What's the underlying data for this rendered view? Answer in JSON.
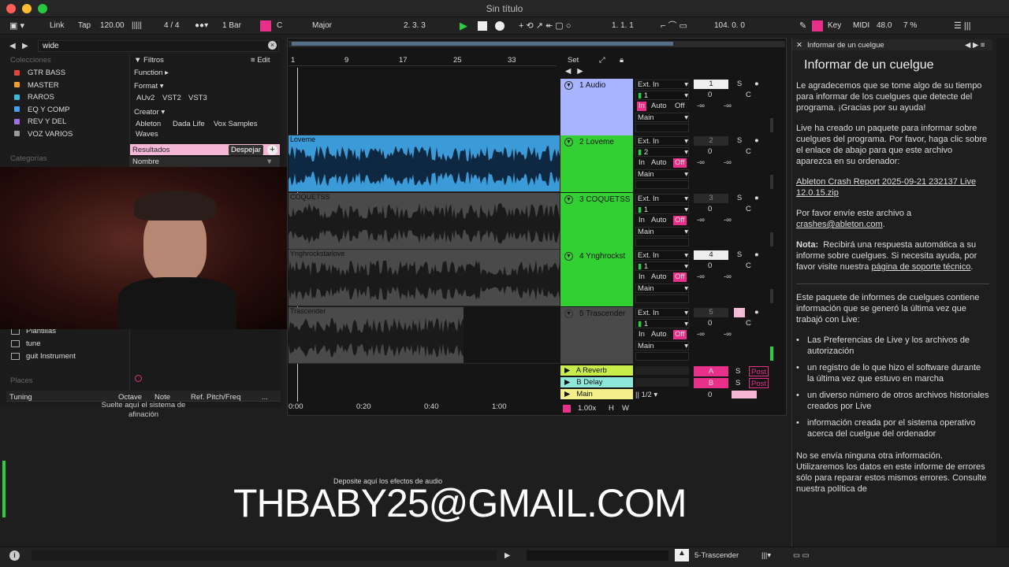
{
  "window": {
    "title": "Sin título"
  },
  "control": {
    "link": "Link",
    "tap": "Tap",
    "tempo": "120.00",
    "signature": "4 / 4",
    "quantize": "1 Bar",
    "key_root": "C",
    "scale": "Major",
    "position": "2.   3.   3",
    "loop_start": "1.   1.   1",
    "loop_length": "104.   0.   0",
    "key_label": "Key",
    "midi_label": "MIDI",
    "cpu_value": "48.0",
    "cpu_percent": "7 %"
  },
  "browser": {
    "search_value": "wide",
    "collections_label": "Colecciones",
    "collections": [
      {
        "label": "GTR BASS",
        "color": "#e0443b"
      },
      {
        "label": "MASTER",
        "color": "#f0a030"
      },
      {
        "label": "RAROS",
        "color": "#3fb8d8"
      },
      {
        "label": "EQ Y COMP",
        "color": "#4aa0f0"
      },
      {
        "label": "REV Y DEL",
        "color": "#a070e0"
      },
      {
        "label": "VOZ VARIOS",
        "color": "#999999"
      }
    ],
    "categories_label": "Categorías",
    "filters_label": "Filtros",
    "edit_label": "Edit",
    "function_label": "Function ▸",
    "format_label": "Format ▾",
    "formats": [
      "AUv2",
      "VST2",
      "VST3"
    ],
    "creator_label": "Creator ▾",
    "creators": [
      "Ableton",
      "Dada Life",
      "Vox Samples",
      "Waves"
    ],
    "results_label": "Resultados",
    "clear_label": "Despejar",
    "name_column": "Nombre",
    "places": [
      "Plantillas",
      "tune",
      "guit Instrument"
    ],
    "places_label": "Places"
  },
  "tuning": {
    "title": "Tuning",
    "col_octave": "Octave",
    "col_note": "Note",
    "col_ref": "Ref. Pitch/Freq",
    "more": "...",
    "drop_hint": "Suelte aquí el sistema de afinación"
  },
  "arrangement": {
    "bar_markers": [
      "1",
      "9",
      "17",
      "25",
      "33"
    ],
    "set_label": "Set",
    "time_markers": [
      "0:00",
      "0:20",
      "0:40",
      "1:00"
    ],
    "zoom": "1.00x",
    "h": "H",
    "w": "W",
    "tracks": [
      {
        "name": "1 Audio",
        "num": "1",
        "color": "#a8b4ff",
        "clip": "",
        "input": "Ext. In",
        "channel": "1",
        "main": "Main",
        "vol": "0",
        "pan": "C"
      },
      {
        "name": "2 Loveme",
        "num": "2",
        "color": "#33d033",
        "clip": "Loveme",
        "input": "Ext. In",
        "channel": "2",
        "main": "Main",
        "vol": "0",
        "pan": "C"
      },
      {
        "name": "3 COQUETSS",
        "num": "3",
        "color": "#33d033",
        "clip": "COQUETSS",
        "input": "Ext. In",
        "channel": "1",
        "main": "Main",
        "vol": "0",
        "pan": "C"
      },
      {
        "name": "4 Ynghrockst",
        "num": "4",
        "color": "#33d033",
        "clip": "Ynghrockstarlove",
        "input": "Ext. In",
        "channel": "1",
        "main": "Main",
        "vol": "0",
        "pan": "C"
      },
      {
        "name": "5 Trascender",
        "num": "5",
        "color": "#4a4a4a",
        "clip": "Trascender",
        "input": "Ext. In",
        "channel": "1",
        "main": "Main",
        "vol": "0",
        "pan": "C"
      }
    ],
    "monitor": {
      "in": "In",
      "auto": "Auto",
      "off": "Off"
    },
    "solo": "S",
    "inf": "-∞",
    "returns": [
      {
        "name": "A Reverb",
        "send": "A",
        "post": "Post"
      },
      {
        "name": "B Delay",
        "send": "B",
        "post": "Post"
      }
    ],
    "main_track": {
      "name": "Main",
      "out": "1/2",
      "vol": "0"
    }
  },
  "device_hint": "Deposite aquí los efectos de audio",
  "watermark": "THBABY25@GMAIL.COM",
  "crash": {
    "panel_title": "Informar de un cuelgue",
    "heading": "Informar de un cuelgue",
    "p1": "Le agradecemos que se tome algo de su tiempo para informar de los cuelgues que detecte del programa. ¡Gracias por su ayuda!",
    "p2": "Live ha creado un paquete para informar sobre cuelgues del programa. Por favor, haga clic sobre el enlace de abajo para que este archivo aparezca en su ordenador:",
    "link1": "Ableton Crash Report 2025-09-21 232137 Live 12.0.15.zip",
    "p3": "Por favor envíe este archivo a",
    "email": "crashes@ableton.com",
    "note_label": "Nota:",
    "note": "Recibirá una respuesta automática a su informe sobre cuelgues. Si necesita ayuda, por favor visite nuestra",
    "note_link": "página de soporte técnico",
    "p4": "Este paquete de informes de cuelgues contiene información que se generó la última vez que trabajó con Live:",
    "items": [
      "Las Preferencias de Live y los archivos de autorización",
      "un registro de lo que hizo el software durante la última vez que estuvo en marcha",
      "un diverso número de otros archivos historiales creados por Live",
      "información creada por el sistema operativo acerca del cuelgue del ordenador"
    ],
    "p5": "No se envía ninguna otra información. Utilizaremos los datos en este informe de errores sólo para reparar estos mismos errores. Consulte nuestra política de"
  },
  "status": {
    "track": "5-Trascender"
  }
}
